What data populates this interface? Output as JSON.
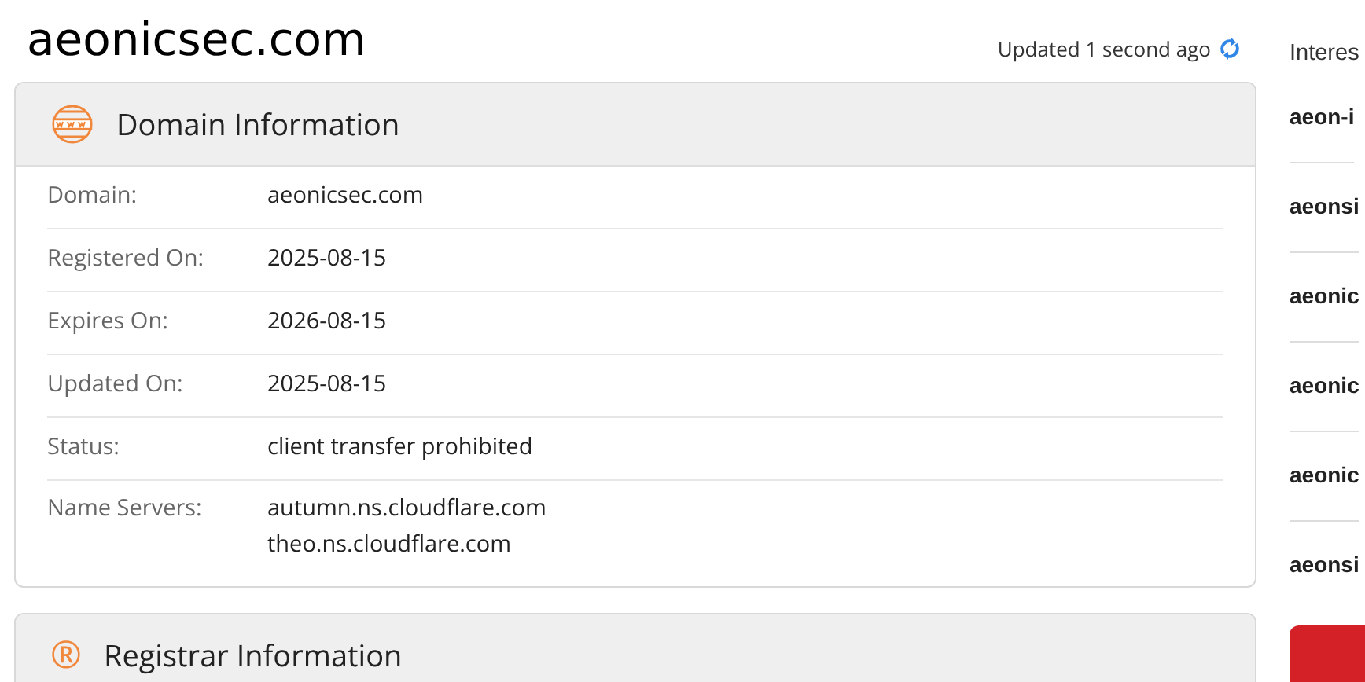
{
  "page_title": "aeonicsec.com",
  "updated": {
    "text": "Updated 1 second ago"
  },
  "sections": [
    {
      "title": "Domain Information",
      "kind": "globe",
      "rows": [
        {
          "label": "Domain:",
          "values": [
            "aeonicsec.com"
          ]
        },
        {
          "label": "Registered On:",
          "values": [
            "2025-08-15"
          ]
        },
        {
          "label": "Expires On:",
          "values": [
            "2026-08-15"
          ]
        },
        {
          "label": "Updated On:",
          "values": [
            "2025-08-15"
          ]
        },
        {
          "label": "Status:",
          "values": [
            "client transfer prohibited"
          ]
        },
        {
          "label": "Name Servers:",
          "values": [
            "autumn.ns.cloudflare.com",
            "theo.ns.cloudflare.com"
          ]
        }
      ]
    },
    {
      "title": "Registrar Information",
      "kind": "symbol",
      "icon": "®"
    }
  ],
  "sidebar": {
    "heading": "Interes",
    "items": [
      "aeon-i",
      "aeonsi",
      "aeonic",
      "aeonic",
      "aeonic",
      "aeonsi"
    ]
  }
}
